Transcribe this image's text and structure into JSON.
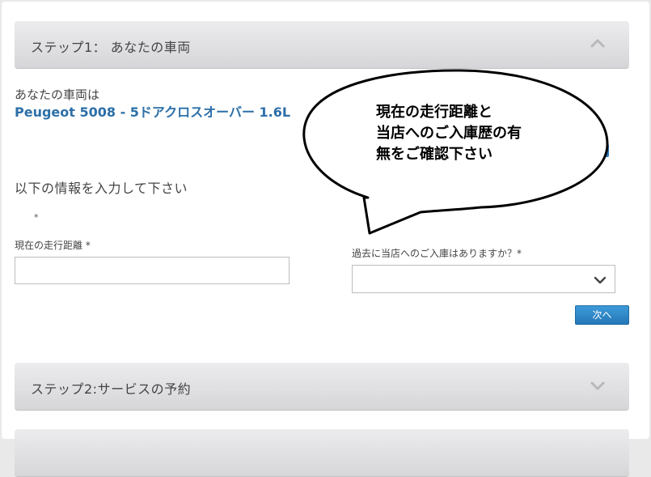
{
  "step1": {
    "title": "ステップ1： あなたの車両",
    "chevron": "chevron-up-icon"
  },
  "vehicle": {
    "label": "あなたの車両は",
    "name": "Peugeot 5008 - 5ドアクロスオーバー 1.6L"
  },
  "form": {
    "intro": "以下の情報を入力して下さい",
    "required_mark": "*",
    "mileage_label": "現在の走行距離 *",
    "mileage_value": "",
    "visit_label": "過去に当店へのご入庫はありますか？*",
    "visit_selected": "",
    "next_label": "次へ"
  },
  "callout": {
    "lines": [
      "現在の走行距離と",
      "当店へのご入庫歴の有",
      "無をご確認下さい"
    ]
  },
  "step2": {
    "title": "ステップ2:サービスの予約",
    "chevron": "chevron-down-icon"
  },
  "colors": {
    "accent": "#2c6fa8",
    "button": "#2f86c9",
    "header_bg": "#dcdcdf"
  }
}
